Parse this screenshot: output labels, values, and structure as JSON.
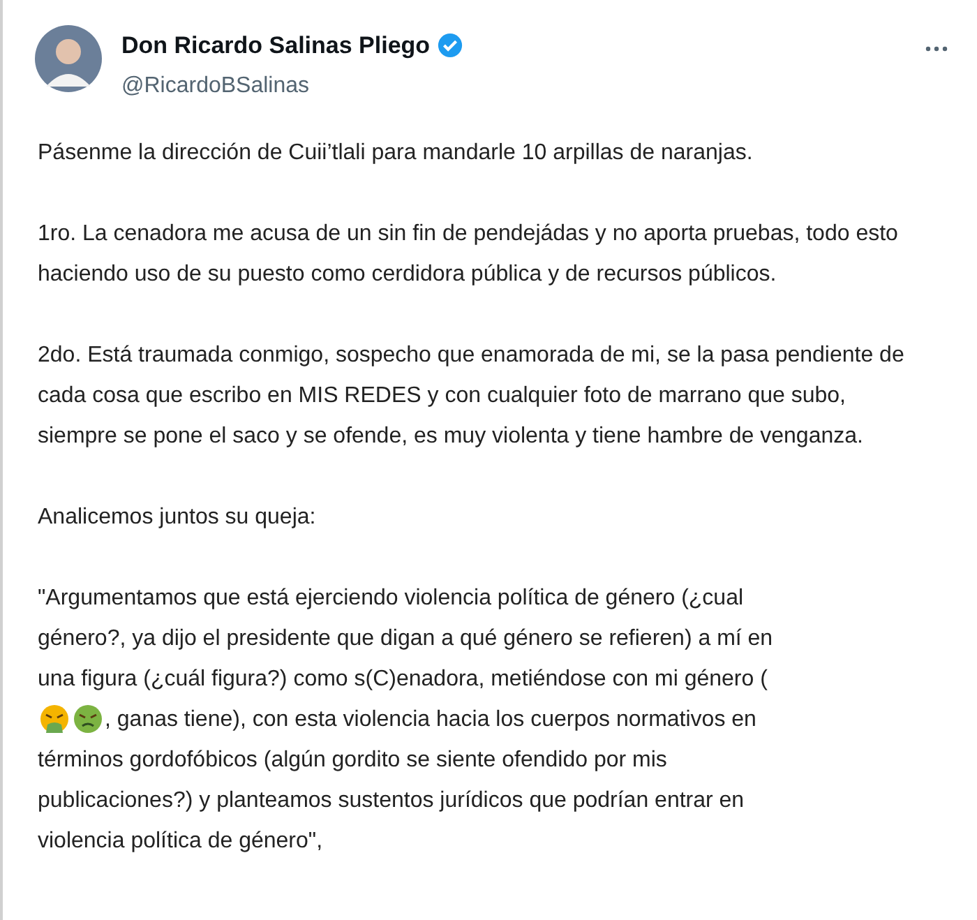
{
  "author": {
    "name": "Don Ricardo Salinas Pliego",
    "verified": true,
    "handle": "@RicardoBSalinas"
  },
  "paragraphs": [
    "Pásenme la dirección de Cuii’tlali para mandarle 10 arpillas de naranjas.",
    "1ro. La cenadora me acusa de un sin fin de pendejádas y no aporta pruebas, todo esto haciendo uso de su puesto como cerdidora pública y de recursos públicos.",
    "2do. Está traumada conmigo, sospecho que enamorada de mi, se la pasa pendiente de cada cosa que escribo en MIS REDES y con cualquier foto de marrano que subo, siempre se pone el saco y se ofende, es muy violenta y tiene hambre de venganza.",
    "Analicemos juntos su queja:"
  ],
  "quote_lines": [
    {
      "kind": "text",
      "text": "\"Argumentamos que está ejerciendo violencia política de género (¿cual"
    },
    {
      "kind": "text",
      "text": "género?, ya dijo el presidente que digan a qué género se refieren) a mí en"
    },
    {
      "kind": "text",
      "text": "una figura (¿cuál figura?) como s(C)enadora, metiéndose con mi género ("
    },
    {
      "kind": "emoji",
      "text": ", ganas tiene), con esta violencia hacia los cuerpos normativos en"
    },
    {
      "kind": "text",
      "text": "términos gordofóbicos (algún gordito se siente ofendido por mis"
    },
    {
      "kind": "text",
      "text": "publicaciones?) y planteamos sustentos jurídicos que podrían entrar en"
    },
    {
      "kind": "text",
      "text": "violencia política de género\","
    }
  ]
}
